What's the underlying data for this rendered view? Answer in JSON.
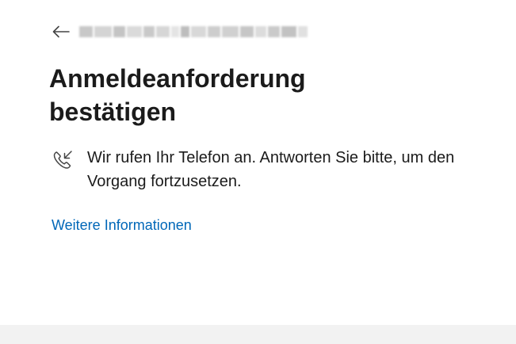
{
  "header": {
    "back_icon": "arrow-left-icon",
    "account_display": "redacted"
  },
  "main": {
    "title": "Anmeldeanforderung bestätigen",
    "message_icon": "phone-incoming-icon",
    "message": "Wir rufen Ihr Telefon an. Antworten Sie bitte, um den Vorgang fortzusetzen.",
    "more_info_link": "Weitere Informationen"
  },
  "colors": {
    "link": "#0067b8",
    "text": "#1b1b1b",
    "footer": "#f2f2f2"
  }
}
